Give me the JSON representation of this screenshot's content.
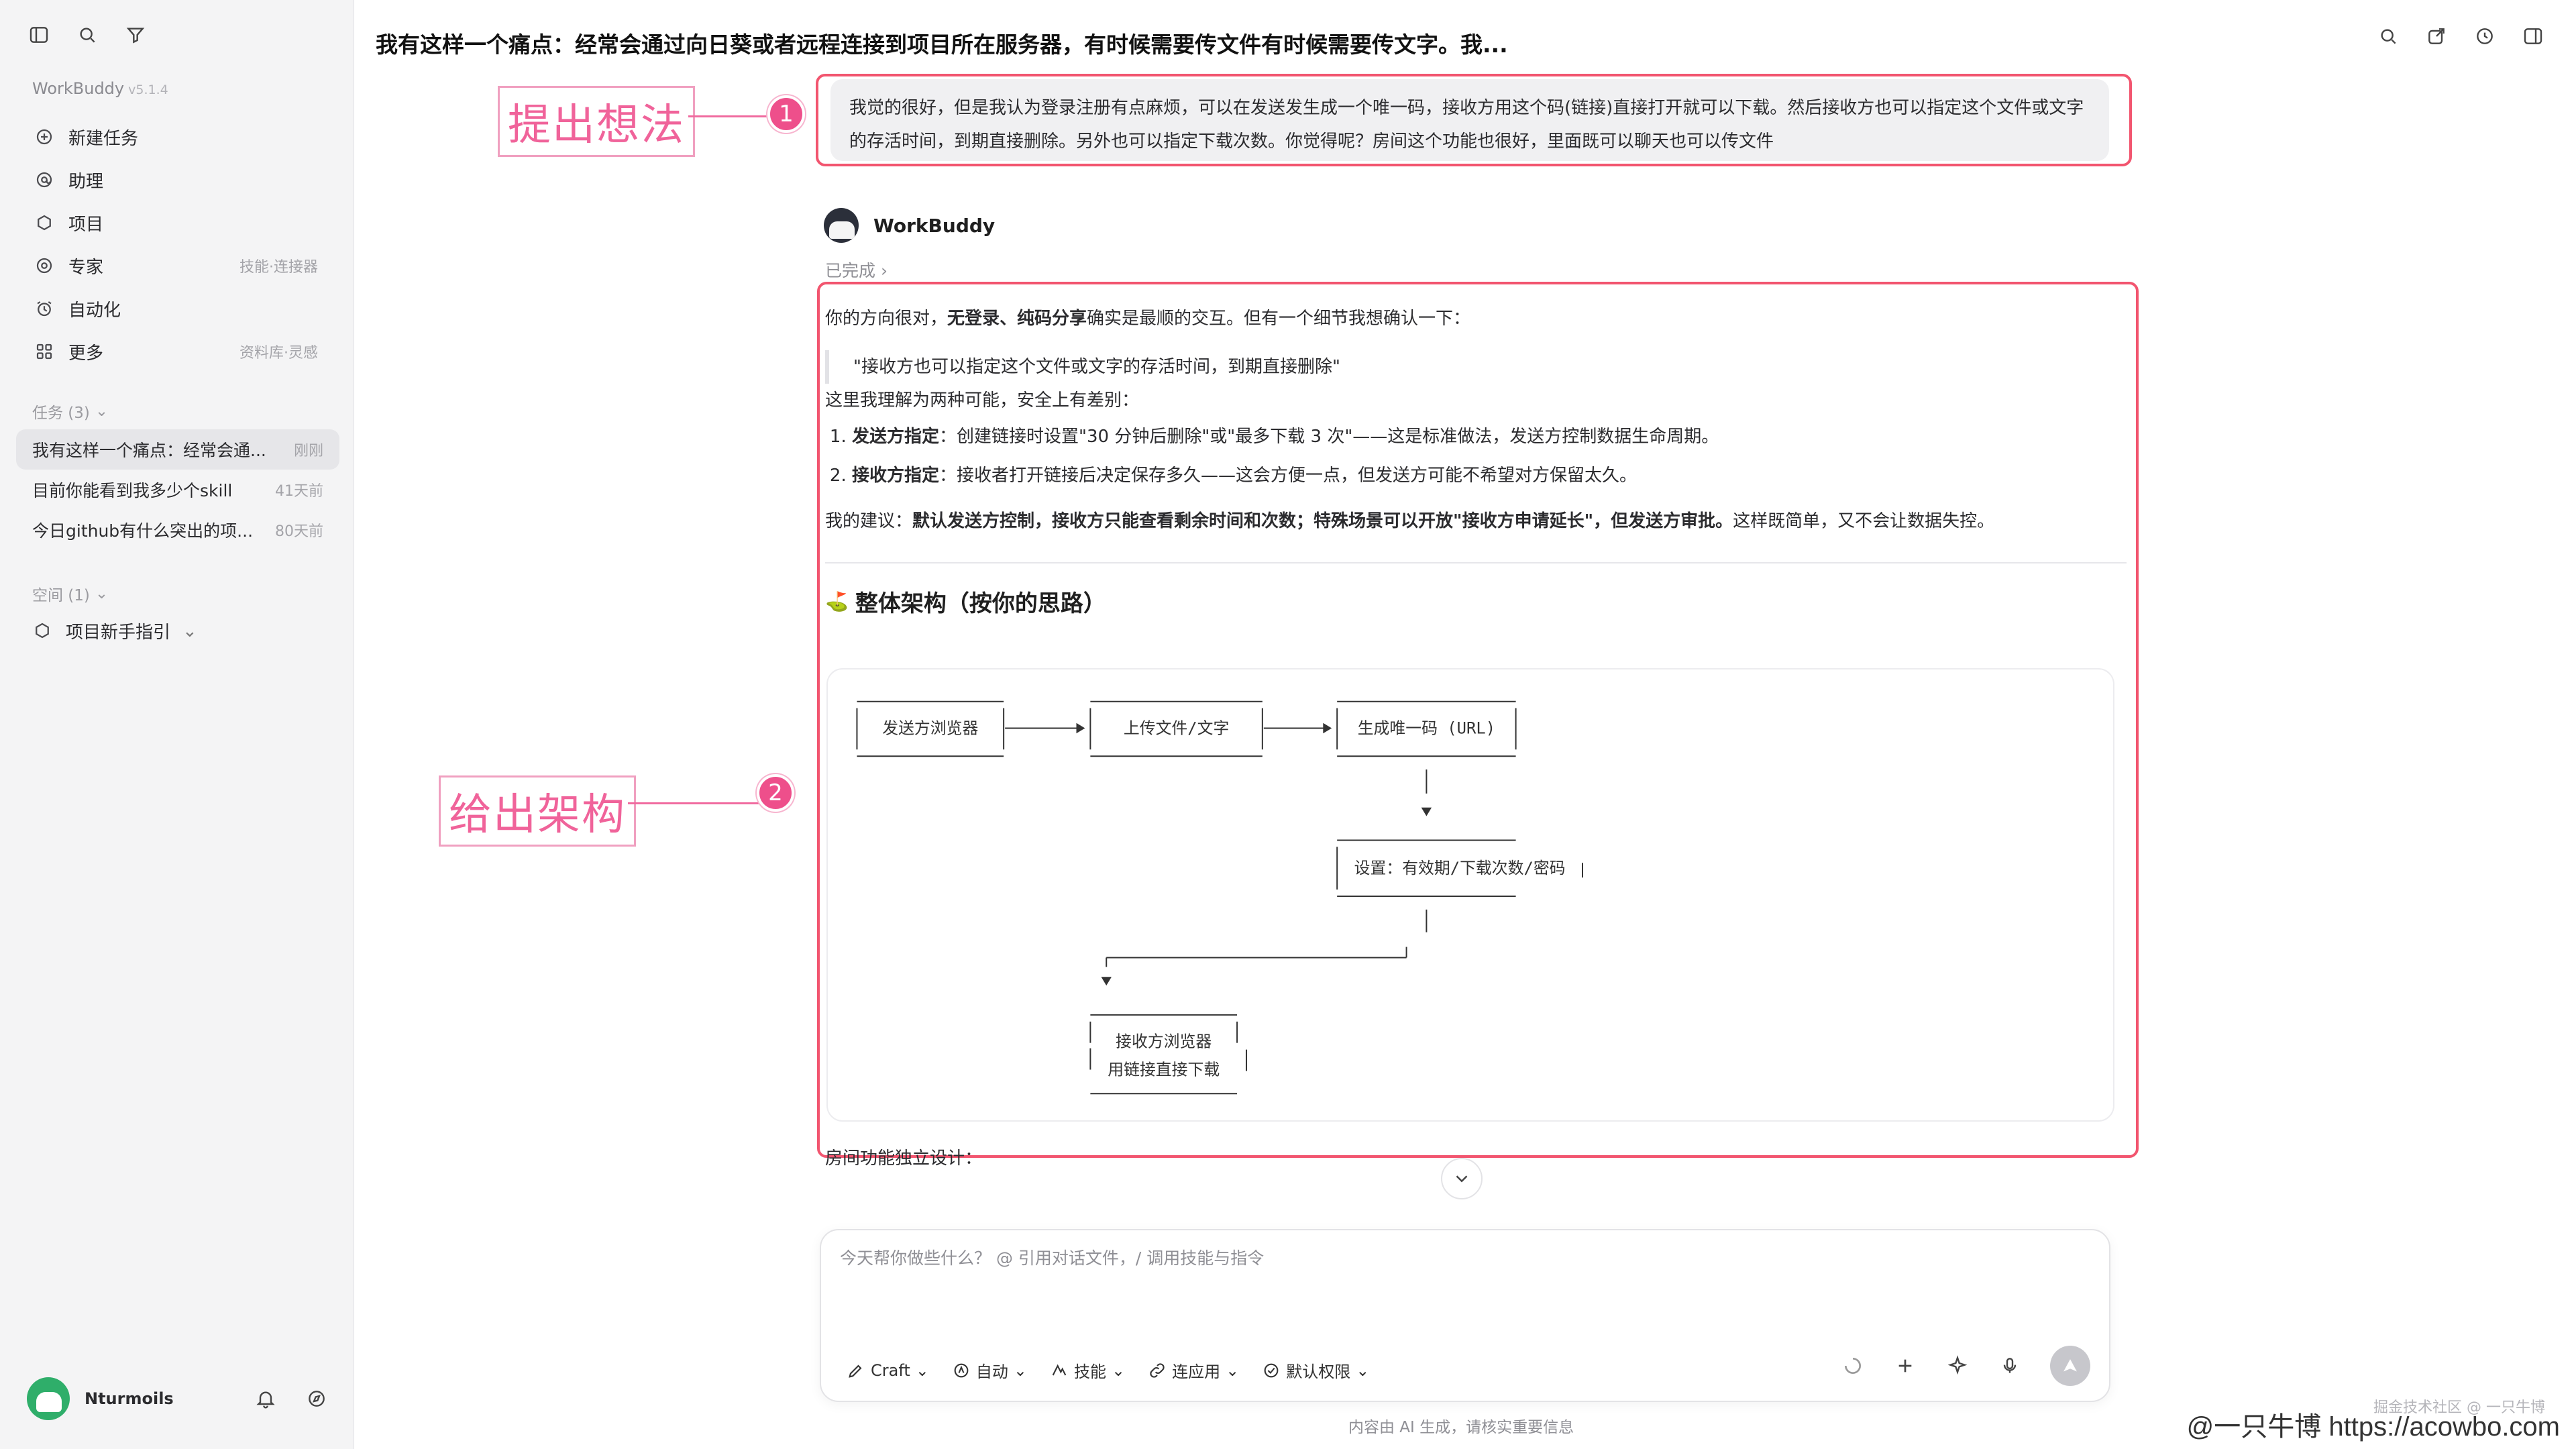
{
  "sidebar": {
    "brand": "WorkBuddy",
    "version": "v5.1.4",
    "menu": [
      {
        "label": "新建任务",
        "hint": ""
      },
      {
        "label": "助理",
        "hint": ""
      },
      {
        "label": "项目",
        "hint": ""
      },
      {
        "label": "专家",
        "hint": "技能·连接器"
      },
      {
        "label": "自动化",
        "hint": ""
      },
      {
        "label": "更多",
        "hint": "资料库·灵感"
      }
    ],
    "tasks_header": "任务 (3)",
    "tasks": [
      {
        "title": "我有这样一个痛点：经常会通...",
        "time": "刚刚"
      },
      {
        "title": "目前你能看到我多少个skill",
        "time": "41天前"
      },
      {
        "title": "今日github有什么突出的项...",
        "time": "80天前"
      }
    ],
    "space_header": "空间 (1)",
    "space_item": "项目新手指引",
    "user_name": "Nturmoils"
  },
  "header": {
    "title": "我有这样一个痛点：经常会通过向日葵或者远程连接到项目所在服务器，有时候需要传文件有时候需要传文字。我..."
  },
  "annotations": {
    "one_label": "提出想法",
    "one_badge": "1",
    "two_label": "给出架构",
    "two_badge": "2"
  },
  "user_message": "我觉的很好，但是我认为登录注册有点麻烦，可以在发送发生成一个唯一码，接收方用这个码(链接)直接打开就可以下载。然后接收方也可以指定这个文件或文字的存活时间，到期直接删除。另外也可以指定下载次数。你觉得呢？房间这个功能也很好，里面既可以聊天也可以传文件",
  "assistant": {
    "name": "WorkBuddy",
    "status": "已完成",
    "p1_a": "你的方向很对，",
    "p1_b": "无登录、纯码分享",
    "p1_c": "确实是最顺的交互。但有一个细节我想确认一下：",
    "quote": "\"接收方也可以指定这个文件或文字的存活时间，到期直接删除\"",
    "p2": "这里我理解为两种可能，安全上有差别：",
    "li1_b": "发送方指定",
    "li1": "：创建链接时设置\"30 分钟后删除\"或\"最多下载 3 次\"——这是标准做法，发送方控制数据生命周期。",
    "li2_b": "接收方指定",
    "li2": "：接收者打开链接后决定保存多久——这会方便一点，但发送方可能不希望对方保留太久。",
    "p3_a": "我的建议：",
    "p3_b": "默认发送方控制，接收方只能查看剩余时间和次数；特殊场景可以开放\"接收方申请延长\"，但发送方审批。",
    "p3_c": "这样既简单，又不会让数据失控。",
    "arch_title": "整体架构（按你的思路）",
    "diagram": {
      "n1": "发送方浏览器",
      "n2": "上传文件/文字",
      "n3": "生成唯一码 (URL)",
      "n4": "设置：有效期/下载次数/密码",
      "n5a": "接收方浏览器",
      "n5b": "用链接直接下载"
    },
    "room_text": "房间功能独立设计："
  },
  "composer": {
    "placeholder": "今天帮你做些什么？ @ 引用对话文件，/ 调用技能与指令",
    "tools": [
      "Craft",
      "自动",
      "技能",
      "连应用",
      "默认权限"
    ],
    "disclaimer": "内容由 AI 生成，请核实重要信息"
  },
  "watermark": {
    "small": "掘金技术社区 @ 一只牛博",
    "big": "@一只牛博 https://acowbo.com"
  },
  "colors": {
    "accent_pink": "#ee4f8b",
    "red_box": "#f2556f",
    "sidebar_bg": "#f4f4f5"
  }
}
